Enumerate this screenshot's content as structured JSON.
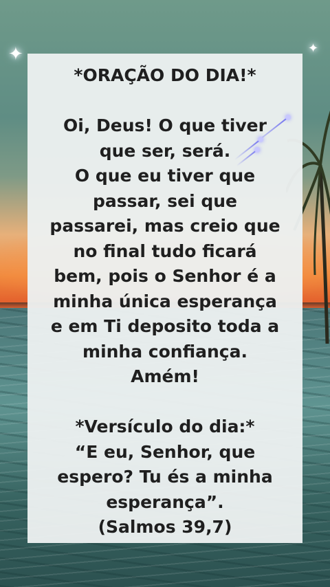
{
  "card": {
    "title": "*ORAÇÃO DO DIA!*",
    "prayer_lines": [
      "Oi, Deus! O que tiver",
      "que ser, será.",
      "O que eu tiver que",
      "passar, sei que",
      "passarei, mas creio que",
      "no final tudo ficará",
      "bem, pois o Senhor é a",
      "minha única esperança",
      "e em Ti deposito toda a",
      "minha confiança.",
      "Amém!"
    ],
    "verse_heading": "*Versículo do dia:*",
    "verse_lines": [
      "“E eu, Senhor, que",
      "espero? Tu és a minha",
      "esperança”."
    ],
    "reference": "(Salmos 39,7)"
  },
  "background": {
    "scene": "sunset-sea-background",
    "accent_colors": [
      "#f08a3e",
      "#5f9491",
      "#ecf0f0"
    ]
  }
}
